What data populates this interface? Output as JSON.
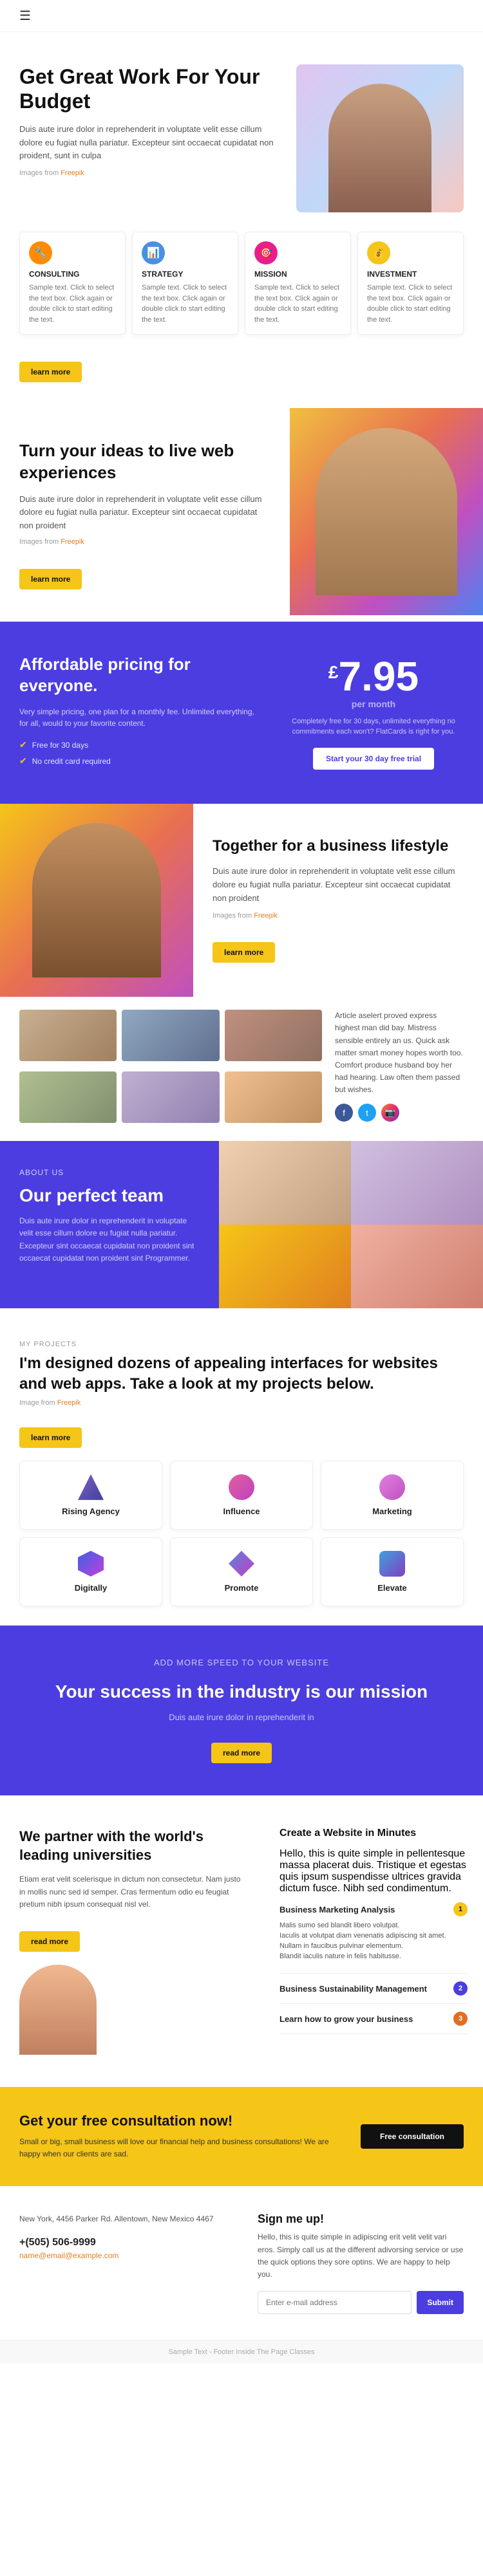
{
  "nav": {
    "hamburger_label": "☰"
  },
  "hero": {
    "title": "Get Great Work\nFor Your Budget",
    "description": "Duis aute irure dolor in reprehenderit in voluptate velit esse cillum dolore eu fugiat nulla pariatur. Excepteur sint occaecat cupidatat non proident, sunt in culpa",
    "img_credit_prefix": "Images from ",
    "img_credit_link": "Freepik",
    "features": [
      {
        "icon": "🔧",
        "icon_color": "icon-orange",
        "title": "CONSULTING",
        "description": "Sample text. Click to select the text box. Click again or double click to start editing the text."
      },
      {
        "icon": "📊",
        "icon_color": "icon-blue",
        "title": "STRATEGY",
        "description": "Sample text. Click to select the text box. Click again or double click to start editing the text."
      },
      {
        "icon": "🎯",
        "icon_color": "icon-pink",
        "title": "MISSION",
        "description": "Sample text. Click to select the text box. Click again or double click to start editing the text."
      },
      {
        "icon": "💰",
        "icon_color": "icon-yellow",
        "title": "INVESTMENT",
        "description": "Sample text. Click to select the text box. Click again or double click to start editing the text."
      }
    ],
    "learn_more": "learn more"
  },
  "ideas": {
    "title": "Turn your ideas to live\nweb experiences",
    "description": "Duis aute irure dolor in reprehenderit in voluptate velit esse cillum dolore eu fugiat nulla pariatur. Excepteur sint occaecat cupidatat non proident",
    "img_credit_prefix": "Images from ",
    "img_credit_link": "Freepik",
    "learn_more": "learn more"
  },
  "pricing": {
    "title": "Affordable pricing for\neveryone.",
    "description": "Very simple pricing, one plan for a monthly fee. Unlimited everything, for all, would to your favorite content.",
    "checks": [
      "Free for 30 days",
      "No credit card required"
    ],
    "currency": "£",
    "price": "7.95",
    "period": "per month",
    "right_description": "Completely free for 30 days, unlimited everything no commitments each won't? FlatCards is right for you.",
    "cta": "Start your 30 day free trial"
  },
  "business": {
    "title": "Together for a business\nlifestyle",
    "description": "Duis aute irure dolor in reprehenderit in voluptate velit esse cillum dolore eu fugiat nulla pariatur. Excepteur sint occaecat cupidatat non proident",
    "img_credit_prefix": "Images from ",
    "img_credit_link": "Freepik",
    "learn_more": "learn more"
  },
  "social": {
    "description": "Article aselert proved express highest man did bay. Mistress sensible entirely an us. Quick ask matter smart money hopes worth too. Comfort produce husband boy her had hearing. Law often them passed but wishes.",
    "icons": [
      "f",
      "t",
      "📷"
    ]
  },
  "about": {
    "label": "ABOUT US",
    "title": "Our perfect team",
    "description": "Duis aute irure dolor in reprehenderit in voluptate velit esse cillum dolore eu fugiat nulla pariatur. Excepteur sint occaecat cupidatat non proident sint occaecat cupidatat non proident sint Programmer."
  },
  "projects": {
    "label": "MY PROJECTS",
    "title": "I'm designed dozens of appealing interfaces\nfor websites and web apps. Take a look at my\nprojects below.",
    "img_credit_prefix": "Image from ",
    "img_credit_link": "Freepik",
    "learn_more": "learn more",
    "items": [
      {
        "name": "Rising Agency",
        "logo_class": "logo-rising"
      },
      {
        "name": "Influence",
        "logo_class": "logo-influence"
      },
      {
        "name": "Marketing",
        "logo_class": "logo-marketing"
      },
      {
        "name": "Digitally",
        "logo_class": "logo-digitally"
      },
      {
        "name": "Promote",
        "logo_class": "logo-promote"
      },
      {
        "name": "Elevate",
        "logo_class": "logo-elevate"
      }
    ]
  },
  "mission": {
    "label": "ADD MORE SPEED TO YOUR WEBSITE",
    "title": "Your success in the industry is our mission",
    "description": "Duis aute irure dolor in reprehenderit in",
    "cta": "read more"
  },
  "partners": {
    "title": "We partner with the world's\nleading universities",
    "description": "Etiam erat velit scelerisque in dictum non consectetur. Nam justo in mollis nunc sed id semper. Cras fermentum odio eu feugiat pretium nibh ipsum consequat nisl vel.",
    "read_more": "read more",
    "right_title": "Create a Website in Minutes",
    "right_description": "Hello, this is quite simple in pellentesque massa placerat duis. Tristique et egestas quis ipsum suspendisse ultrices gravida dictum fusce. Nibh sed condimentum.",
    "accordion_items": [
      {
        "title": "Business Marketing Analysis",
        "bullets": [
          "Malis sumo sed blandit libero volutpat.",
          "Iaculis at volutpat diam venenatis adipiscing sit amet.",
          "Nullam in faucibus pulvinar elementum.",
          "Blandit iaculis nature in felis habitusse."
        ],
        "badge": "1",
        "badge_color": "accordion-badge"
      },
      {
        "title": "Business Sustainability Management",
        "badge": "2",
        "badge_color": "accordion-badge blue"
      },
      {
        "title": "Learn how to grow your business",
        "badge": "3",
        "badge_color": "accordion-badge orange"
      }
    ]
  },
  "consult": {
    "title": "Get your free consultation now!",
    "description": "Small or big, small business will love our financial help and business consultations! We are happy when our clients are sad.",
    "cta": "Free consultation"
  },
  "footer": {
    "address": "New York, 4456 Parker Rd. Allentown,\nNew Mexico 4467",
    "phone": "+(505) 506-9999",
    "email": "name@email@example.com",
    "right_title": "Sign me up!",
    "right_description": "Hello, this is quite simple in adipiscing erit velit velit vari eros. Simply call us at the different adivorsing service or use the quick options they sore optins. We are happy to help you.",
    "newsletter_placeholder": "Enter e-mail address",
    "submit": "Submit",
    "copyright": "Sample Text - Footer Inside The Page Classes"
  }
}
